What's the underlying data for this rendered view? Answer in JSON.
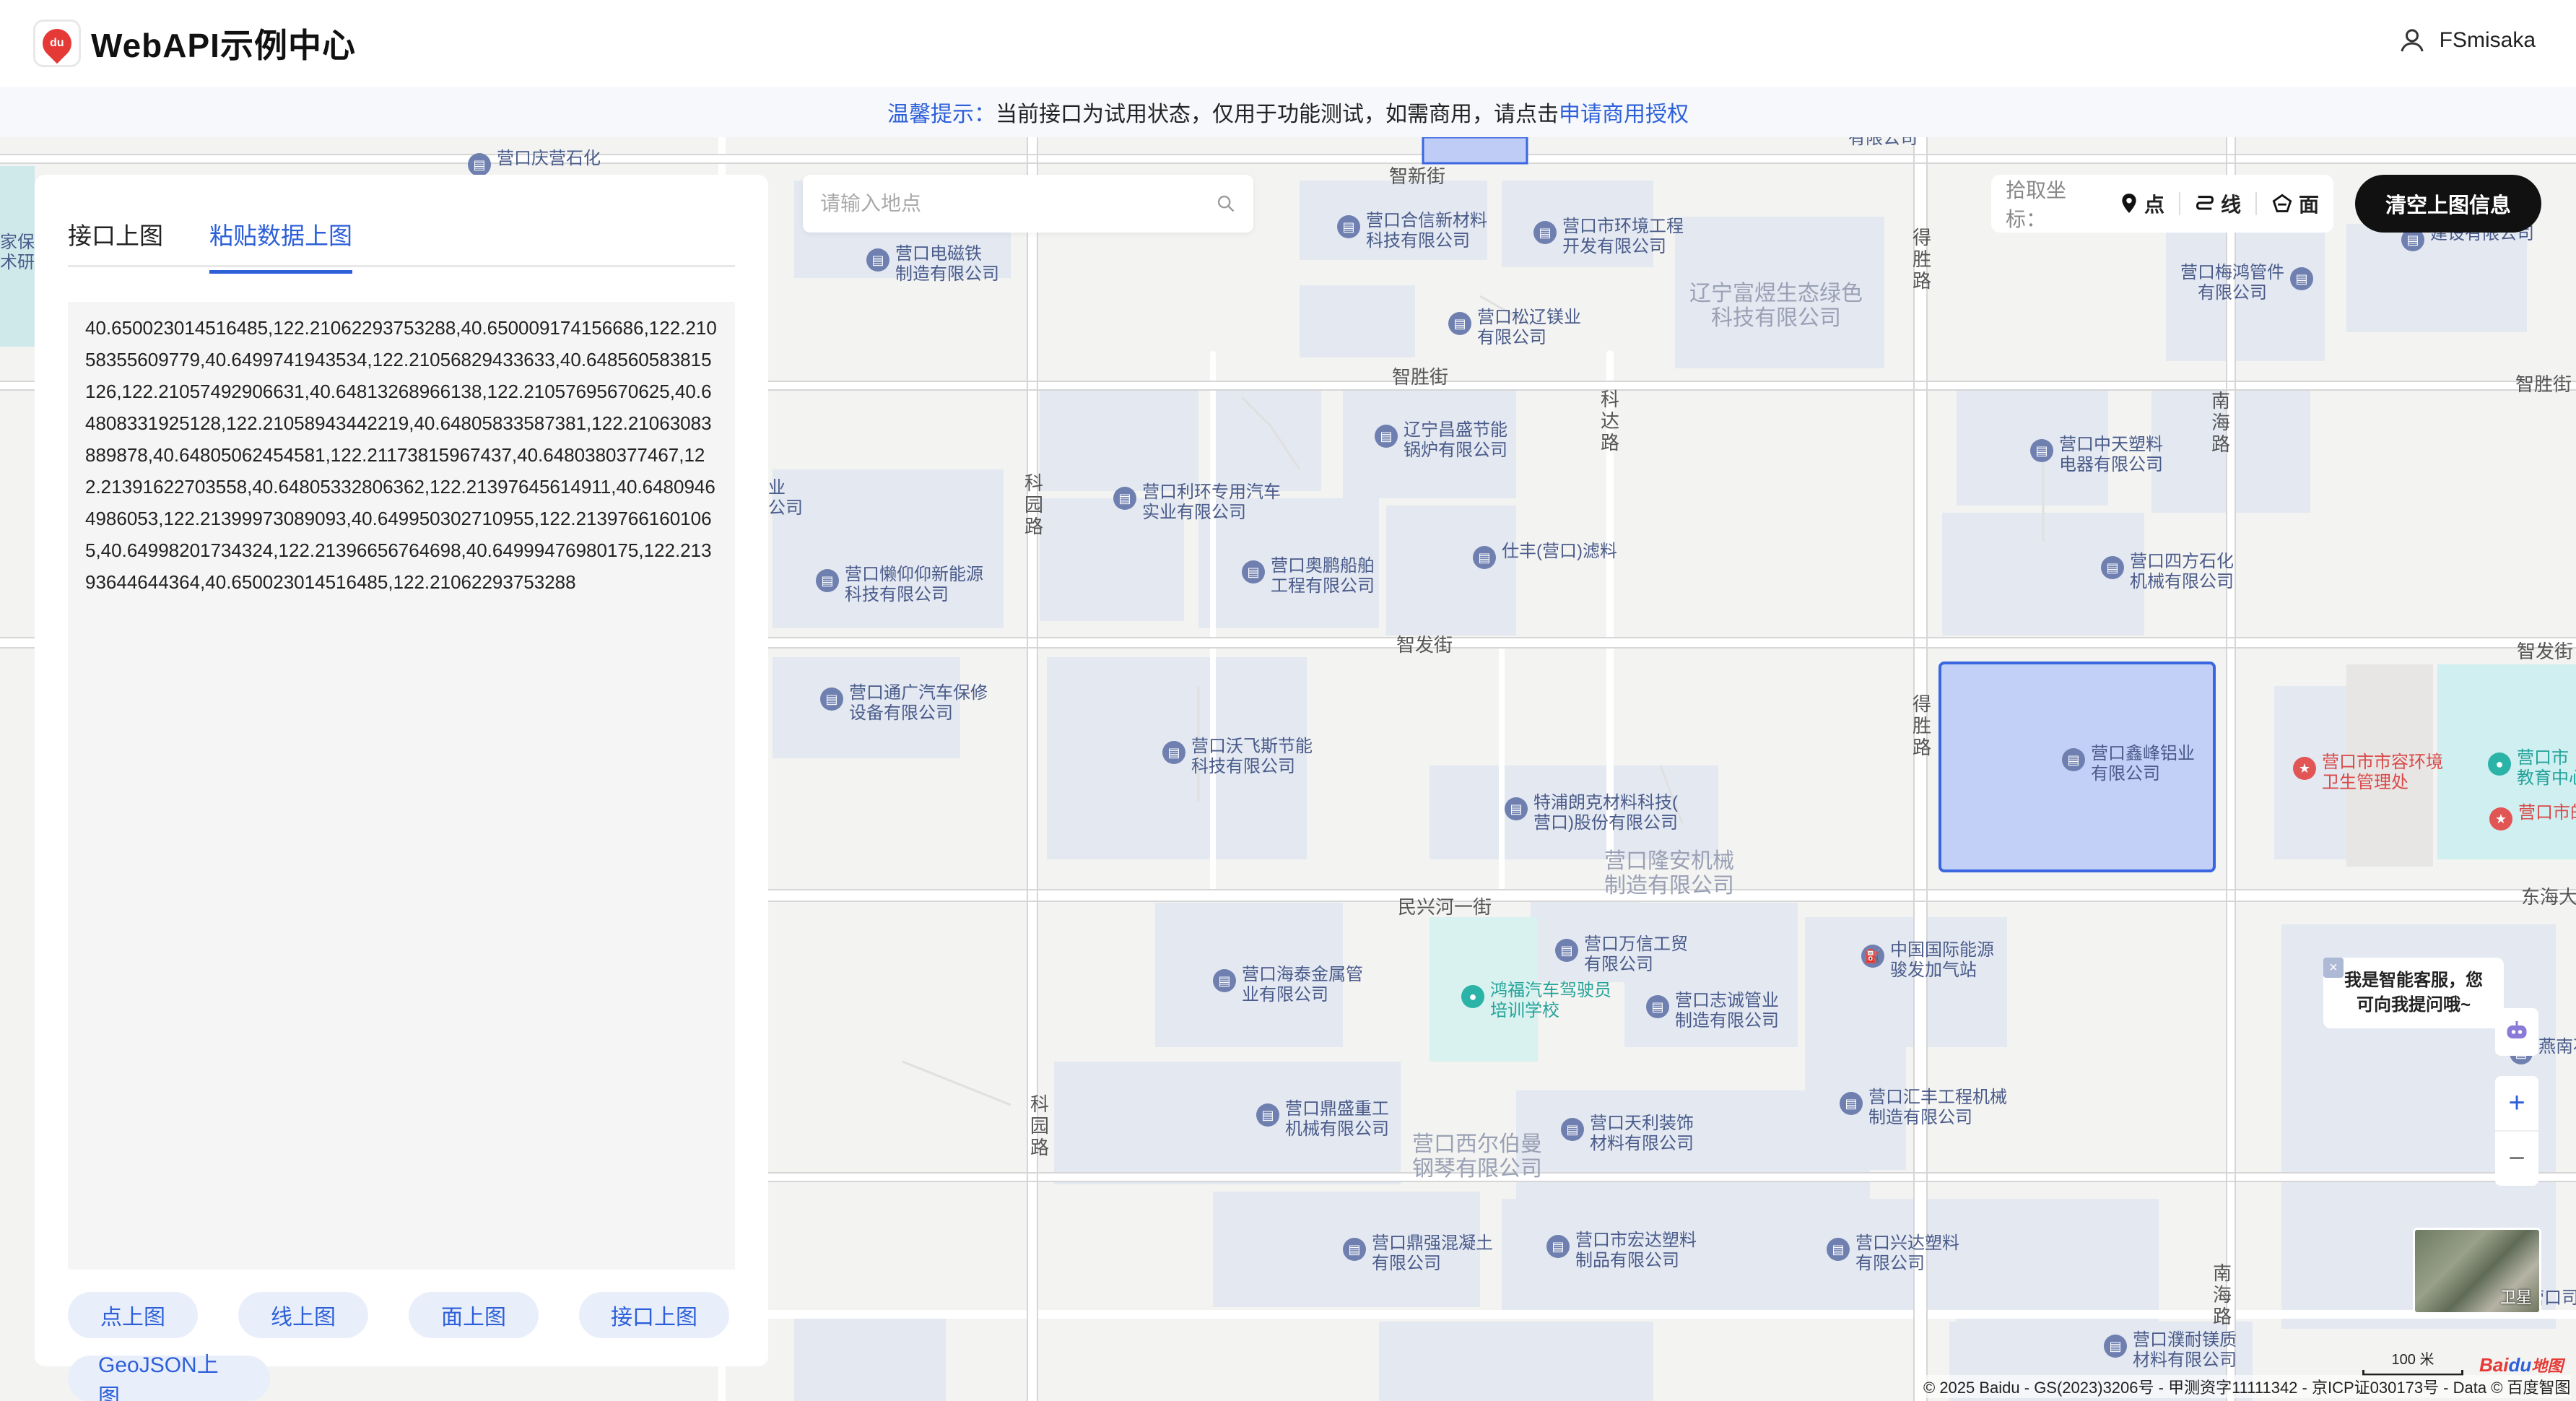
{
  "header": {
    "logo_text": "du",
    "brand": "WebAPI示例中心",
    "username": "FSmisaka"
  },
  "notice": {
    "tip": "温馨提示：",
    "text": "当前接口为试用状态，仅用于功能测试，如需商用，请点击",
    "link": "申请商用授权"
  },
  "panel": {
    "tabs": [
      "接口上图",
      "粘贴数据上图"
    ],
    "active_tab": 1,
    "textarea_value": "40.650023014516485,122.21062293753288,40.650009174156686,122.21058355609779,40.6499741943534,122.21056829433633,40.648560583815126,122.21057492906631,40.64813268966138,122.21057695670625,40.64808331925128,122.21058943442219,40.64805833587381,122.21063083889878,40.64805062454581,122.21173815967437,40.6480380377467,122.21391622703558,40.64805332806362,122.21397645614911,40.64809464986053,122.21399973089093,40.649950302710955,122.21397661601065,40.64998201734324,122.21396656764698,40.64999476980175,122.21393644644364,40.650023014516485,122.21062293753288",
    "buttons": [
      "点上图",
      "线上图",
      "面上图",
      "接口上图"
    ],
    "geojson_button": "GeoJSON上图"
  },
  "search": {
    "placeholder": "请输入地点",
    "icon": "search-icon"
  },
  "picker": {
    "label": "拾取坐标：",
    "point": "点",
    "line": "线",
    "polygon": "面"
  },
  "clear_button": "清空上图信息",
  "assistant": {
    "message_line1": "我是智能客服，您",
    "message_line2": "可向我提问哦~",
    "close": "×"
  },
  "zoom": {
    "in": "+",
    "out": "−"
  },
  "satellite_label": "卫星",
  "scale": "100 米",
  "baidu_logo_a": "Bai",
  "baidu_logo_b": "du",
  "baidu_logo_c": "地图",
  "copyright": "© 2025 Baidu - GS(2023)3206号 - 甲测资字11111342 - 京ICP证030173号 - Data © 百度智图",
  "colors": {
    "accent": "#2c5fd8",
    "polygon_fill": "#bfccf5",
    "polygon_stroke": "#3a66e0"
  },
  "map": {
    "roads": {
      "zhixin": "智新街",
      "zhisheng": "智胜街",
      "zhisheng_r": "智胜街",
      "zhifa": "智发街",
      "zhifa_r": "智发街",
      "minxing": "民兴河一街",
      "donghai": "东海大街",
      "deshenglu1": "得胜路",
      "deshenglu2": "得胜路",
      "keyuanlu1": "科园路",
      "keyuanlu2": "科园路",
      "kedalu": "科达路",
      "nanhailu1": "南海路",
      "nanhailu2": "南海路"
    },
    "pois": {
      "p1": "营口庆营石化",
      "p2a": "营口电磁铁",
      "p2b": "制造有限公司",
      "p3a": "营口合信新材料",
      "p3b": "科技有限公司",
      "p4a": "营口市环境工程",
      "p4b": "开发有限公司",
      "p5a": "营口松辽镁业",
      "p5b": "有限公司",
      "p6a": "营口梅鸿管件",
      "p6b": "有限公司",
      "p7b": "建设有限公司",
      "p8a": "辽宁昌盛节能",
      "p8b": "锅炉有限公司",
      "p9a": "营口利环专用汽车",
      "p9b": "实业有限公司",
      "p10a": "营口中天塑料",
      "p10b": "电器有限公司",
      "p11a": "营口懒仰仰新能源",
      "p11b": "科技有限公司",
      "p12a": "营口奥鹏船舶",
      "p12b": "工程有限公司",
      "p13": "仕丰(营口)滤料",
      "p14a": "营口四方石化",
      "p14b": "机械有限公司",
      "p15a": "营口通广汽车保修",
      "p15b": "设备有限公司",
      "p16a": "营口沃飞斯节能",
      "p16b": "科技有限公司",
      "p17a": "特浦朗克材料科技(",
      "p17b": "营口)股份有限公司",
      "p18a": "营口鑫峰铝业",
      "p18b": "有限公司",
      "p19a": "营口市市容环境",
      "p19b": "卫生管理处",
      "p20a": "营口市",
      "p20b": "教育中心",
      "p21": "营口市的",
      "p22a": "营口万信工贸",
      "p22b": "有限公司",
      "p23a": "营口海泰金属管",
      "p23b": "业有限公司",
      "p24a": "鸿福汽车驾驶员",
      "p24b": "培训学校",
      "p25a": "营口志诚管业",
      "p25b": "制造有限公司",
      "p26a": "中国国际能源",
      "p26b": "骏发加气站",
      "p27": "燕南石化",
      "p28a": "营口鼎盛重工",
      "p28b": "机械有限公司",
      "p29a": "营口天利装饰",
      "p29b": "材料有限公司",
      "p30a": "营口汇丰工程机械",
      "p30b": "制造有限公司",
      "p31a": "营口鼎强混凝土",
      "p31b": "有限公司",
      "p32a": "营口市宏达塑料",
      "p32b": "制品有限公司",
      "p33a": "营口兴达塑料",
      "p33b": "有限公司",
      "p34a": "营口濮耐镁质",
      "p34b": "材料有限公司",
      "p35": "营口司",
      "p36a": "家保",
      "p36b": "术研",
      "p37a": "业",
      "p37b": "公司",
      "p38": "有限公司"
    },
    "areas": {
      "a1a": "辽宁富煜生态绿色",
      "a1b": "科技有限公司",
      "a2a": "营口隆安机械",
      "a2b": "制造有限公司",
      "a3a": "营口西尔伯曼",
      "a3b": "钢琴有限公司"
    }
  }
}
